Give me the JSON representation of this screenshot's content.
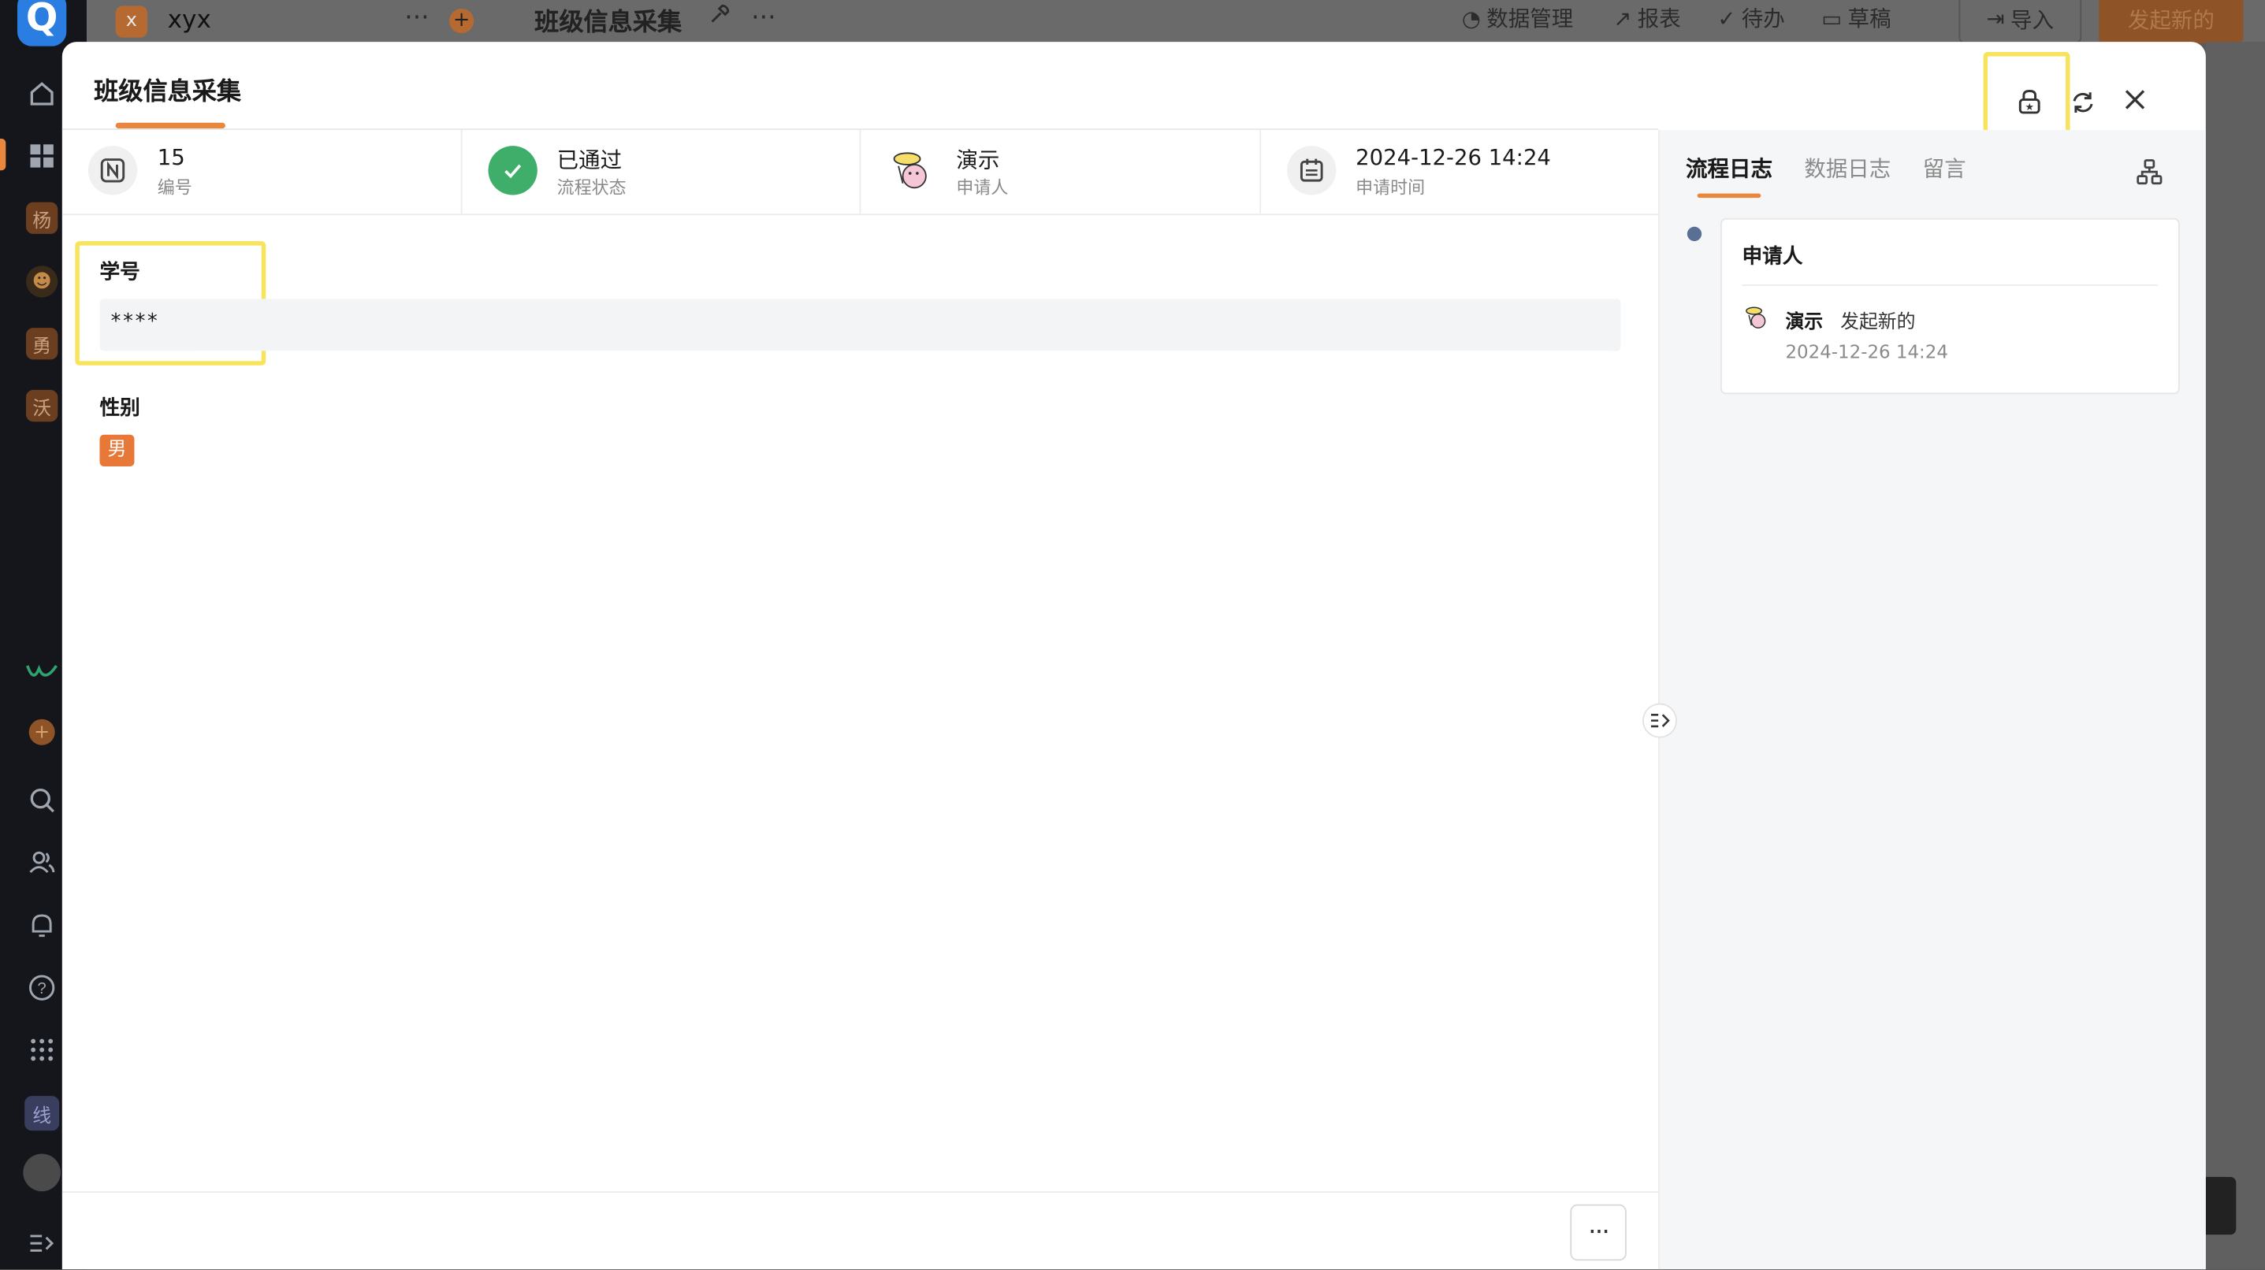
{
  "topbar": {
    "app_initial": "x",
    "app_name": "xyx",
    "form_title": "班级信息采集",
    "menu": [
      "数据管理",
      "报表",
      "待办",
      "草稿"
    ],
    "import_label": "导入",
    "new_label": "发起新的"
  },
  "sidebar": {
    "avatars": [
      "杨",
      "☻",
      "勇",
      "沃"
    ],
    "bottom_tag": "线"
  },
  "modal": {
    "title": "班级信息采集",
    "info": [
      {
        "value": "15",
        "label": "编号",
        "icon": "id-icon"
      },
      {
        "value": "已通过",
        "label": "流程状态",
        "icon": "check-circle-icon"
      },
      {
        "value": "演示",
        "label": "申请人",
        "icon": "user-avatar"
      },
      {
        "value": "2024-12-26 14:24",
        "label": "申请时间",
        "icon": "calendar-icon"
      }
    ],
    "fields": {
      "student_id_label": "学号",
      "student_id_value": "****",
      "gender_label": "性别",
      "gender_value": "男"
    },
    "more_label": "···"
  },
  "right_panel": {
    "tabs": [
      "流程日志",
      "数据日志",
      "留言"
    ],
    "active_tab": 0,
    "log": {
      "heading": "申请人",
      "user": "演示",
      "action": "发起新的",
      "time": "2024-12-26 14:24"
    }
  },
  "colors": {
    "accent": "#e8873d",
    "success": "#3fae6a",
    "highlight": "#f7e35c",
    "timeline_dot": "#5a6f94"
  }
}
